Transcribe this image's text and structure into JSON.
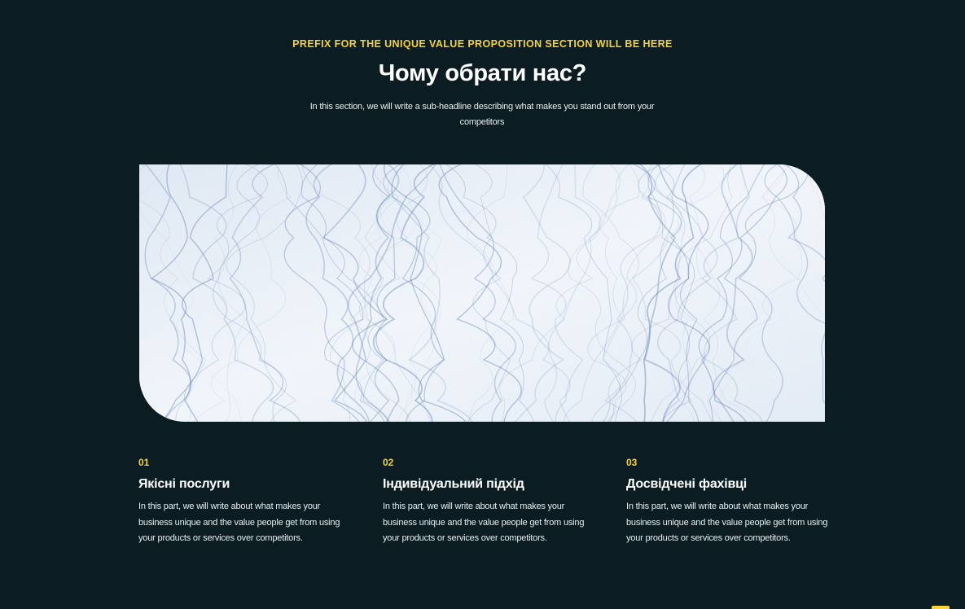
{
  "section": {
    "prefix": "PREFIX FOR THE UNIQUE VALUE PROPOSITION SECTION WILL BE HERE",
    "title": "Чому обрати нас?",
    "subtitle": "In this section, we will write a sub-headline describing what makes you stand out from your competitors"
  },
  "features": [
    {
      "number": "01",
      "title": "Якісні послуги",
      "description": "In this part, we will write about what makes your business unique and the value people get from using your products or services over competitors."
    },
    {
      "number": "02",
      "title": "Індивідуальний підхід",
      "description": "In this part, we will write about what makes your business unique and the value people get from using your products or services over competitors."
    },
    {
      "number": "03",
      "title": "Досвідчені фахівці",
      "description": "In this part, we will write about what makes your business unique and the value people get from using your products or services over competitors."
    }
  ],
  "colors": {
    "background": "#0b1d22",
    "accent": "#f5d33c",
    "text": "#ffffff",
    "hero_base": "#eaf1f8",
    "hero_lines": "#5a7fb5"
  }
}
